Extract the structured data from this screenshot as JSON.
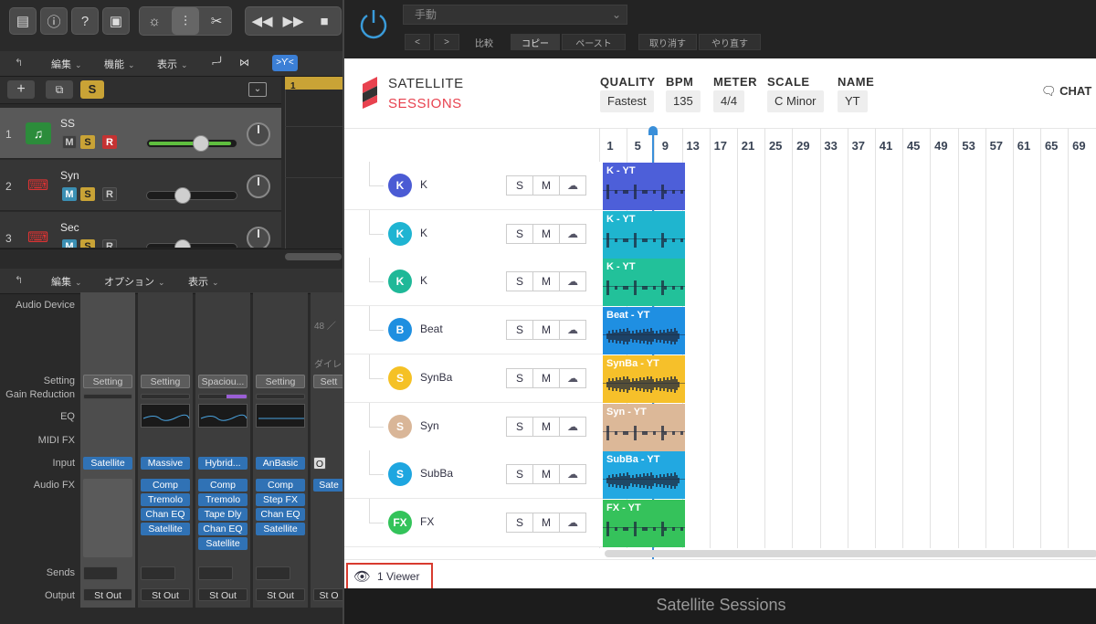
{
  "logic": {
    "top_tabs": [
      "編集",
      "機能",
      "表示"
    ],
    "tracks": [
      {
        "num": "1",
        "name": "SS",
        "m": "M",
        "s": "S",
        "r": "R",
        "selected": true,
        "volume": 0.6
      },
      {
        "num": "2",
        "name": "Syn",
        "m": "M",
        "s": "S",
        "r": "R",
        "selected": false,
        "volume": 0.37
      },
      {
        "num": "3",
        "name": "Sec",
        "m": "M",
        "s": "S",
        "r": "R",
        "selected": false,
        "volume": 0.37
      }
    ],
    "ruler_marker": "1",
    "add_s_label": "S",
    "mixer_menus": [
      "編集",
      "オプション",
      "表示"
    ],
    "mixer_labels": {
      "audio_device": "Audio Device",
      "setting": "Setting",
      "gain_reduction": "Gain Reduction",
      "eq": "EQ",
      "midi_fx": "MIDI FX",
      "input": "Input",
      "audio_fx": "Audio FX",
      "sends": "Sends",
      "output": "Output"
    },
    "strips": [
      {
        "setting": "Setting",
        "input": "Satellite",
        "fx": [],
        "output": "St Out",
        "has_eq": false
      },
      {
        "setting": "Setting",
        "input": "Massive",
        "fx": [
          "Comp",
          "Tremolo",
          "Chan EQ",
          "Satellite"
        ],
        "output": "St Out",
        "has_eq": true
      },
      {
        "setting": "Spaciou...",
        "input": "Hybrid...",
        "fx": [
          "Comp",
          "Tremolo",
          "Tape Dly",
          "Chan EQ",
          "Satellite"
        ],
        "output": "St Out",
        "has_eq": true
      },
      {
        "setting": "Setting",
        "input": "AnBasic",
        "fx": [
          "Comp",
          "Step FX",
          "Chan EQ",
          "Satellite"
        ],
        "output": "St Out",
        "has_eq": true
      },
      {
        "setting": "Sett",
        "input": "O",
        "fx": [
          "Sate"
        ],
        "output": "St O",
        "has_eq": false
      }
    ],
    "partial_strip_text": "48 ／",
    "partial_strip_text2": "ダイレ"
  },
  "plugin": {
    "preset": "手動",
    "compare": "比較",
    "copy": "コピー",
    "paste": "ペースト",
    "undo": "取り消す",
    "redo": "やり直す",
    "footer_title": "Satellite Sessions"
  },
  "satellite": {
    "brand1": "SATELLITE",
    "brand2": "SESSIONS",
    "quality_label": "QUALITY",
    "quality": "Fastest",
    "bpm_label": "BPM",
    "bpm": "135",
    "meter_label": "METER",
    "meter": "4/4",
    "scale_label": "SCALE",
    "scale": "C Minor",
    "name_label": "NAME",
    "name": "YT",
    "chat": "CHAT",
    "ruler": [
      "1",
      "5",
      "9",
      "13",
      "17",
      "21",
      "25",
      "29",
      "33",
      "37",
      "41",
      "45",
      "49",
      "53",
      "57",
      "61",
      "65",
      "69"
    ],
    "tracks": [
      {
        "initial": "K",
        "name": "K",
        "avatar_color": "#4b5bd4",
        "clip": "K - YT",
        "clip_color": "#4d5fd9"
      },
      {
        "initial": "K",
        "name": "K",
        "avatar_color": "#1fb4d2",
        "clip": "K - YT",
        "clip_color": "#1fb5cf"
      },
      {
        "initial": "K",
        "name": "K",
        "avatar_color": "#1fb898",
        "clip": "K - YT",
        "clip_color": "#22c19a"
      },
      {
        "initial": "B",
        "name": "Beat",
        "avatar_color": "#1e8fe0",
        "clip": "Beat - YT",
        "clip_color": "#1f8fe2"
      },
      {
        "initial": "S",
        "name": "SynBa",
        "avatar_color": "#f5c125",
        "clip": "SynBa - YT",
        "clip_color": "#f6c02a"
      },
      {
        "initial": "S",
        "name": "Syn",
        "avatar_color": "#d9b698",
        "clip": "Syn - YT",
        "clip_color": "#dcb898"
      },
      {
        "initial": "S",
        "name": "SubBa",
        "avatar_color": "#1ea6e0",
        "clip": "SubBa - YT",
        "clip_color": "#22a8e1"
      },
      {
        "initial": "FX",
        "name": "FX",
        "avatar_color": "#33c35a",
        "clip": "FX - YT",
        "clip_color": "#35c25b"
      }
    ],
    "s_label": "S",
    "m_label": "M",
    "viewer": "1 Viewer"
  }
}
